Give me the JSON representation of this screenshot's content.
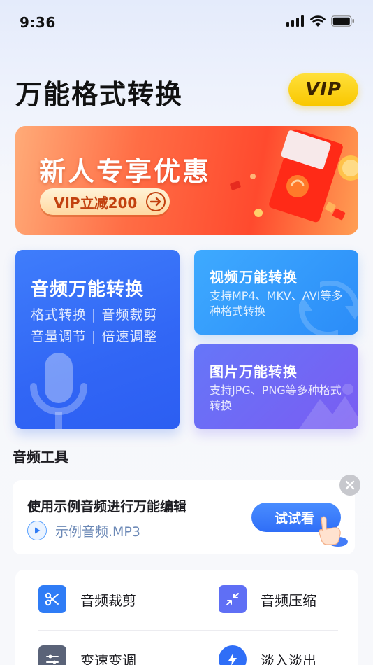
{
  "status_bar": {
    "time": "9:36"
  },
  "header": {
    "title": "万能格式转换",
    "vip_label": "VIP"
  },
  "banner": {
    "title": "新人专享优惠",
    "button_label": "VIP立减200"
  },
  "cards": {
    "audio": {
      "title": "音频万能转换",
      "line1": "格式转换 | 音频裁剪",
      "line2": "音量调节 | 倍速调整"
    },
    "video": {
      "title": "视频万能转换",
      "desc": "支持MP4、MKV、AVI等多种格式转换"
    },
    "image": {
      "title": "图片万能转换",
      "desc": "支持JPG、PNG等多种格式转换"
    }
  },
  "audio_tools": {
    "section_title": "音频工具",
    "example": {
      "title": "使用示例音频进行万能编辑",
      "file_name": "示例音频.MP3",
      "try_label": "试试看"
    },
    "tools": [
      {
        "label": "音频裁剪",
        "icon": "scissors-icon",
        "color": "#2f7cf6"
      },
      {
        "label": "音频压缩",
        "icon": "compress-icon",
        "color": "#5f6ff5"
      },
      {
        "label": "变速变调",
        "icon": "sliders-icon",
        "color": "#5a6378"
      },
      {
        "label": "淡入淡出",
        "icon": "bolt-icon",
        "color": "#2f6ef7"
      }
    ]
  },
  "colors": {
    "accent": "#2f6ef7",
    "vip": "#fbd21a",
    "banner": "#ff5a36"
  }
}
